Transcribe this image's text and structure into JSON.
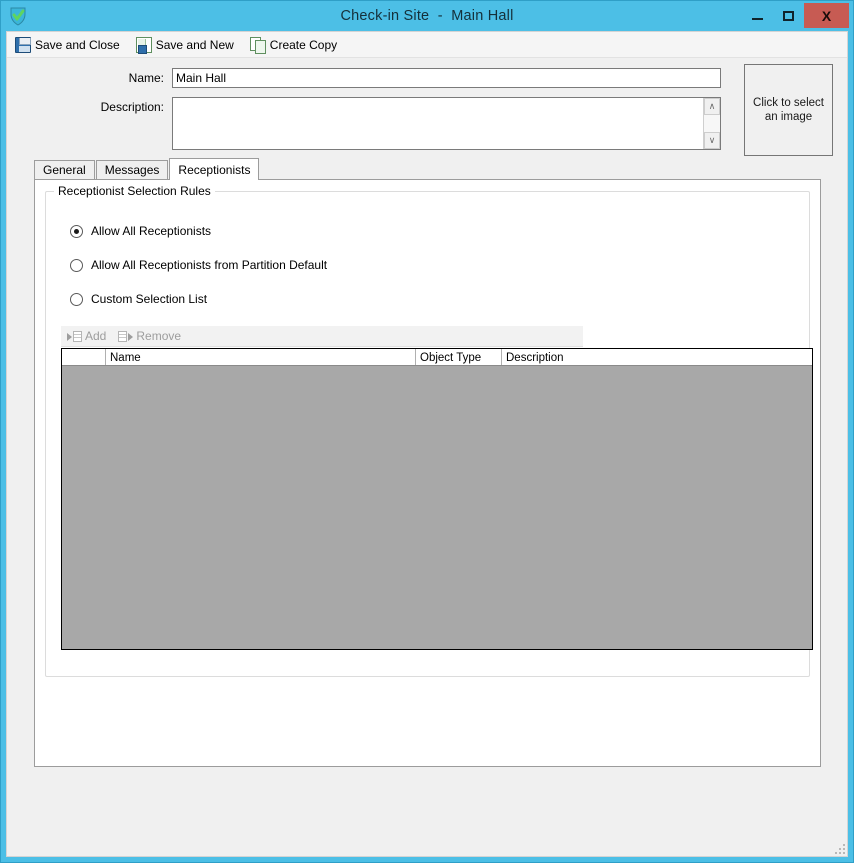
{
  "window": {
    "title": "Check-in Site  -  Main Hall",
    "app_icon": "shield-check-icon",
    "accent_color": "#4cbfe6",
    "close_color": "#c75b53",
    "controls": {
      "minimize_label": "minimize",
      "maximize_label": "maximize",
      "close_label": "X"
    }
  },
  "toolbar": {
    "items": [
      {
        "label": "Save and Close",
        "icon": "floppy-disk-icon"
      },
      {
        "label": "Save and New",
        "icon": "document-save-icon"
      },
      {
        "label": "Create Copy",
        "icon": "copy-pages-icon"
      }
    ]
  },
  "form": {
    "name_label": "Name:",
    "name_value": "Main Hall",
    "name_placeholder": "",
    "description_label": "Description:",
    "description_value": "",
    "description_placeholder": "",
    "image_picker_line1": "Click to select",
    "image_picker_line2": "an image",
    "scroll_up": "∧",
    "scroll_down": "∨"
  },
  "tabs": [
    {
      "label": "General",
      "active": false
    },
    {
      "label": "Messages",
      "active": false
    },
    {
      "label": "Receptionists",
      "active": true
    }
  ],
  "receptionists_tab": {
    "groupbox_title": "Receptionist Selection Rules",
    "radios": [
      {
        "label": "Allow All Receptionists",
        "checked": true
      },
      {
        "label": "Allow All Receptionists from Partition Default",
        "checked": false
      },
      {
        "label": "Custom Selection List",
        "checked": false
      }
    ],
    "list_toolbar": [
      {
        "label": "Add",
        "icon": "add-to-list-icon",
        "disabled": true
      },
      {
        "label": "Remove",
        "icon": "remove-from-list-icon",
        "disabled": true
      }
    ],
    "grid": {
      "columns": [
        "",
        "Name",
        "Object Type",
        "Description"
      ],
      "rows": [],
      "disabled": true,
      "disabled_background": "#a8a8a8"
    }
  }
}
